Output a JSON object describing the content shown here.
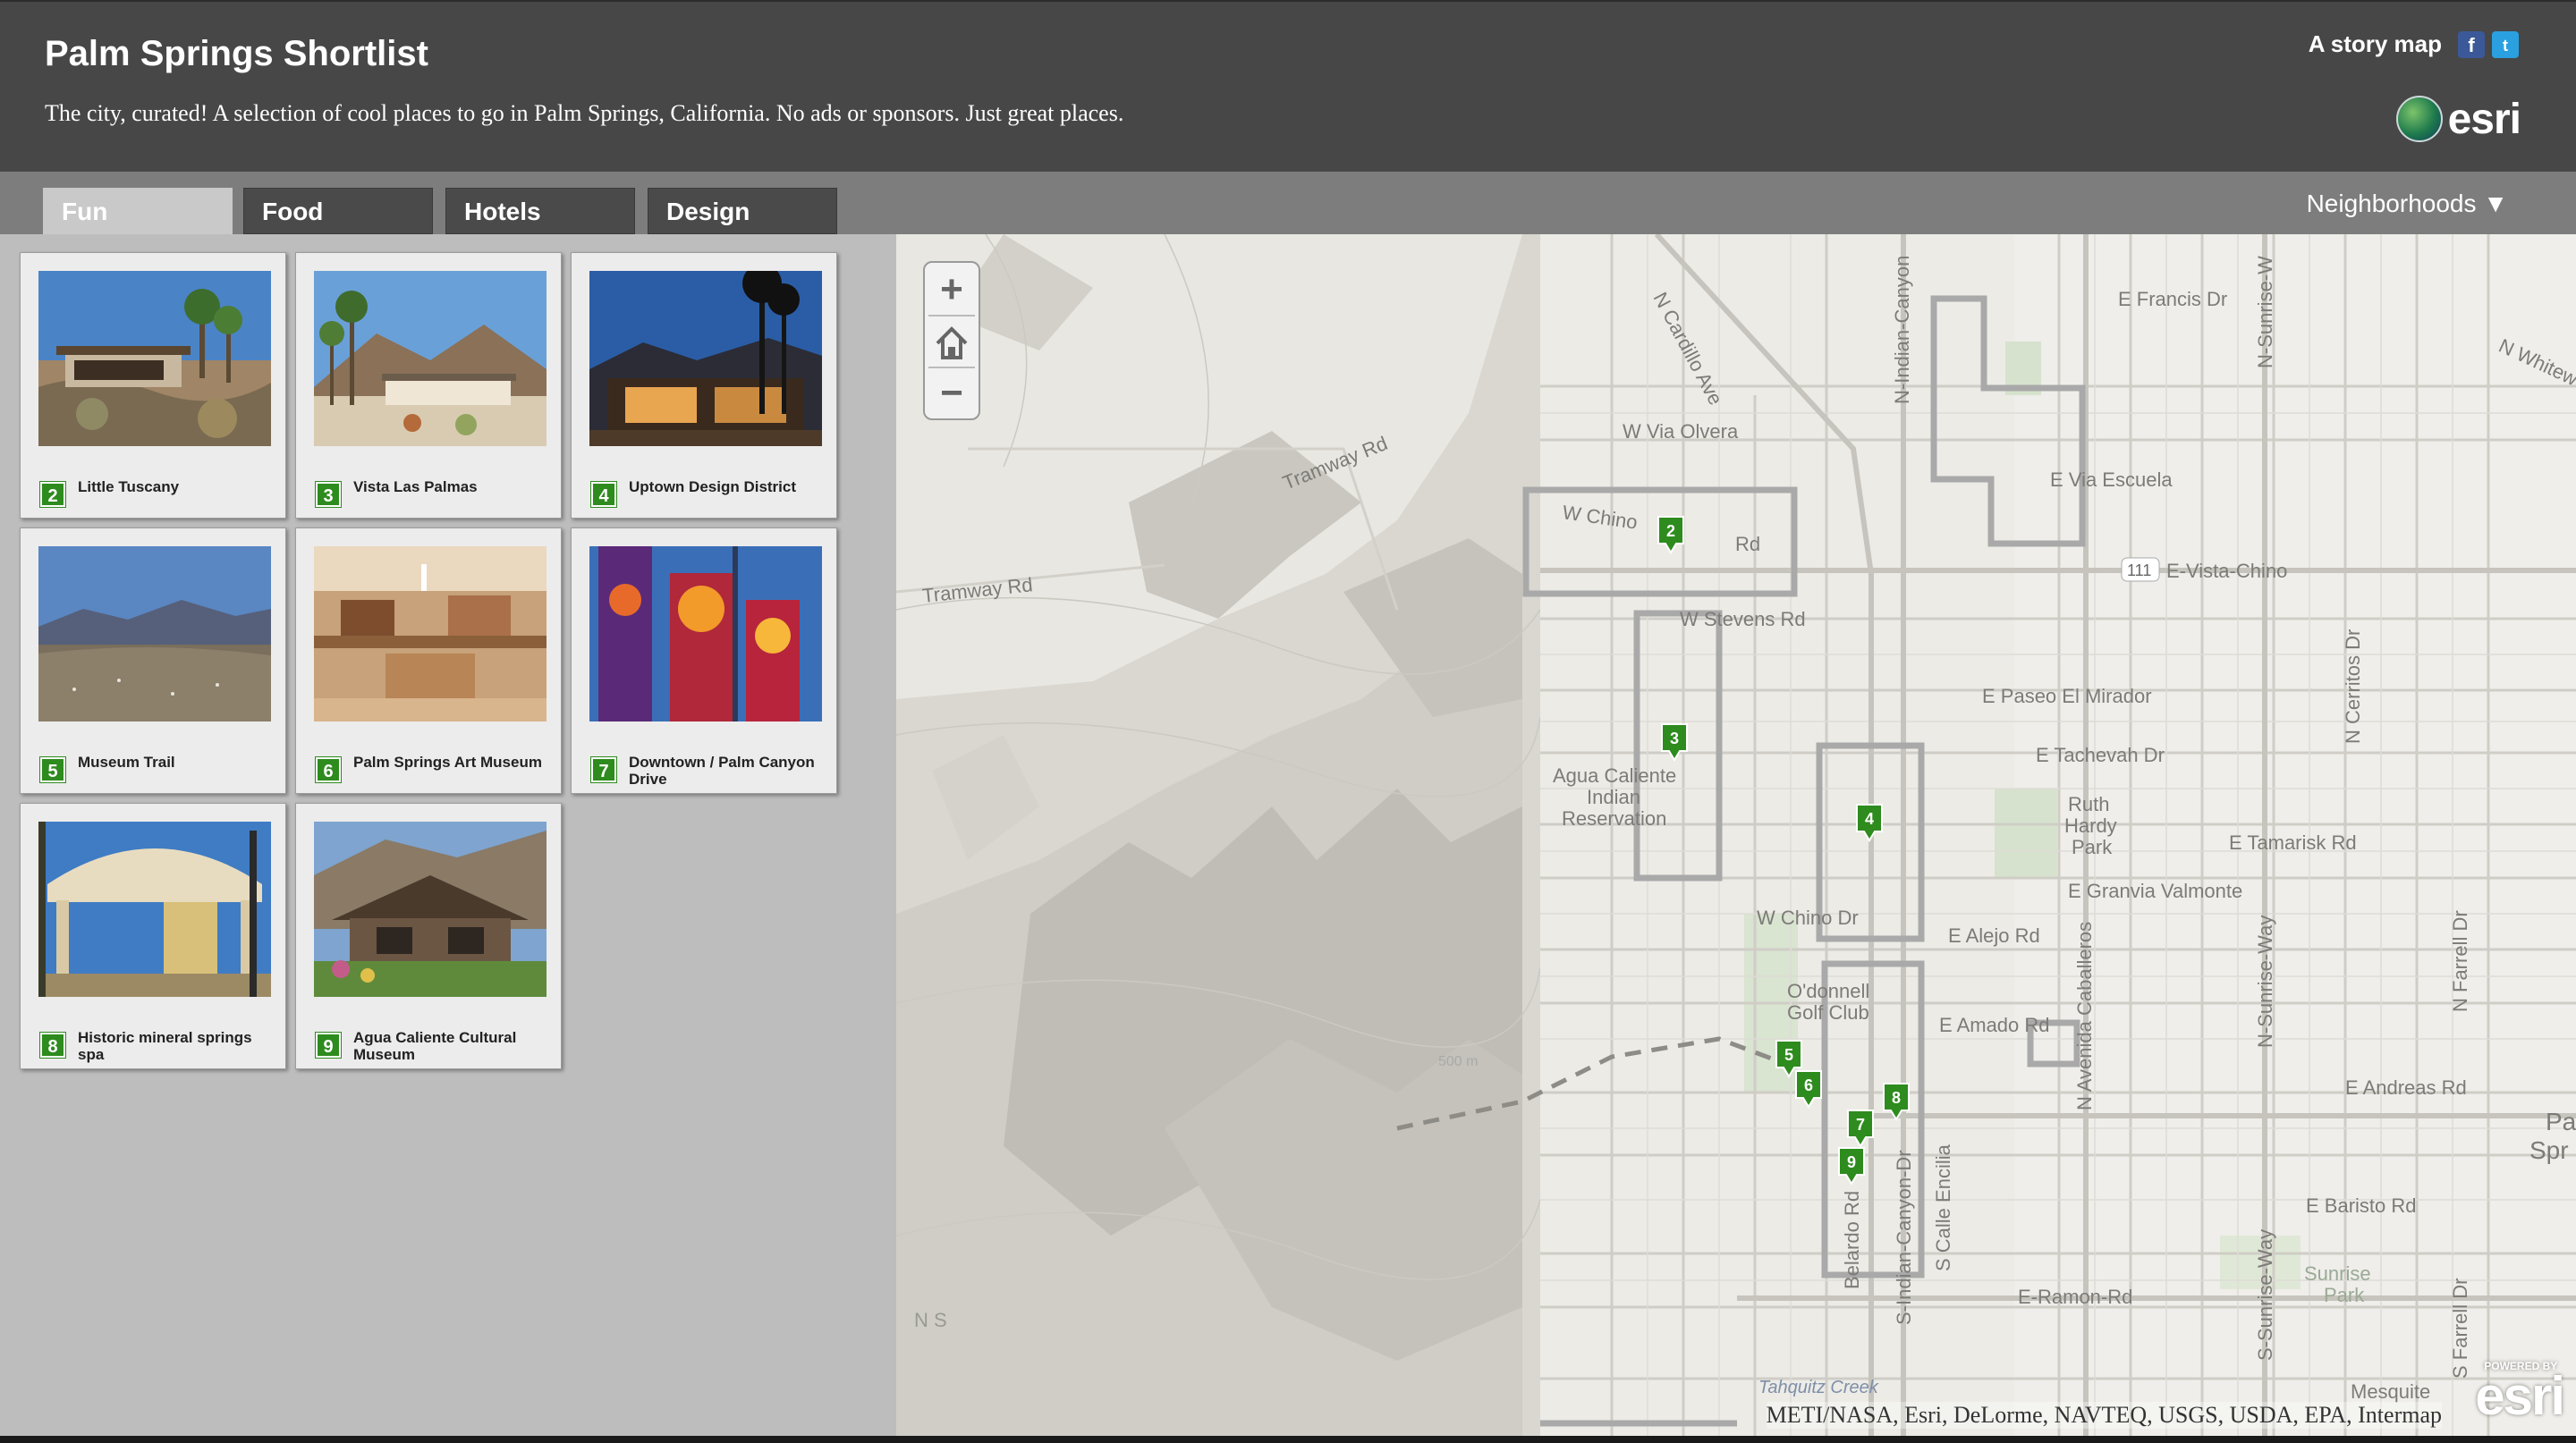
{
  "header": {
    "title": "Palm Springs Shortlist",
    "subtitle": "The city, curated! A selection of cool places to go in Palm Springs, California. No ads or sponsors. Just great places.",
    "story_map_label": "A story map",
    "facebook_glyph": "f",
    "twitter_glyph": "t",
    "logo_text": "esri"
  },
  "tabs": [
    {
      "label": "Fun",
      "active": true
    },
    {
      "label": "Food",
      "active": false
    },
    {
      "label": "Hotels",
      "active": false
    },
    {
      "label": "Design",
      "active": false
    }
  ],
  "neighborhoods": {
    "label": "Neighborhoods ▼"
  },
  "cards": [
    {
      "number": "2",
      "caption": "Little Tuscany"
    },
    {
      "number": "3",
      "caption": "Vista Las Palmas"
    },
    {
      "number": "4",
      "caption": "Uptown Design District"
    },
    {
      "number": "5",
      "caption": "Museum Trail"
    },
    {
      "number": "6",
      "caption": "Palm Springs Art Museum"
    },
    {
      "number": "7",
      "caption": "Downtown / Palm Canyon Drive"
    },
    {
      "number": "8",
      "caption": "Historic mineral springs spa"
    },
    {
      "number": "9",
      "caption": "Agua Caliente Cultural Museum"
    }
  ],
  "map": {
    "zoom_in": "+",
    "zoom_out": "−",
    "attribution": "METI/NASA, Esri, DeLorme, NAVTEQ, USGS, USDA, EPA, Intermap",
    "powered_small": "POWERED BY",
    "powered_logo": "esri",
    "markers": [
      "2",
      "3",
      "4",
      "5",
      "6",
      "7",
      "8",
      "9"
    ],
    "labels": {
      "francis": "E Francis Dr",
      "white": "N Whitew",
      "cardillo": "N Cardillo Ave",
      "via_olvera": "W Via Olvera",
      "tramway_top": "Tramway Rd",
      "tramway_left": "Tramway Rd",
      "chino": "W Chino",
      "canyon_rd": "Rd",
      "via_escuela": "E Via Escuela",
      "vista_chino": "E-Vista-Chino",
      "hwy": "111",
      "stevens": "W Stevens Rd",
      "mirador": "E Paseo El Mirador",
      "tachevah": "E Tachevah Dr",
      "cerritos": "N Cerritos Dr",
      "ruth1": "Ruth",
      "ruth2": "Hardy",
      "ruth3": "Park",
      "agua1": "Agua Caliente",
      "agua2": "Indian",
      "agua3": "Reservation",
      "tamarisk": "E Tamarisk Rd",
      "granvia": "E Granvia Valmonte",
      "chino_dr": "W Chino Dr",
      "alejo": "E Alejo Rd",
      "oddonnell1": "O'donnell",
      "oddonnell2": "Golf Club",
      "amado": "E Amado Rd",
      "andreas": "E Andreas Rd",
      "palm1": "Pa",
      "palm2": "Spr",
      "baristo": "E Baristo Rd",
      "sunrise1": "Sunrise",
      "sunrise2": "Park",
      "ramon": "E-Ramon-Rd",
      "mesquite": "Mesquite",
      "tahquitz": "Tahquitz Creek",
      "contour": "500 m",
      "indian_canyon": "N-Indian-Canyon",
      "indian_canyon_s": "S-Indian-Canyon-Dr",
      "sunrise_way": "N-Sunrise-Way",
      "sunrise_way_s": "S-Sunrise-Way",
      "sunrise_w_top": "N-Sunrise-W",
      "farrell": "N Farrell Dr",
      "farrell_s": "S Farrell Dr",
      "caballeros": "N Avenida Caballeros",
      "belardo": "Belardo Rd",
      "calle": "S Calle Encilia",
      "ns": "N  S"
    }
  }
}
